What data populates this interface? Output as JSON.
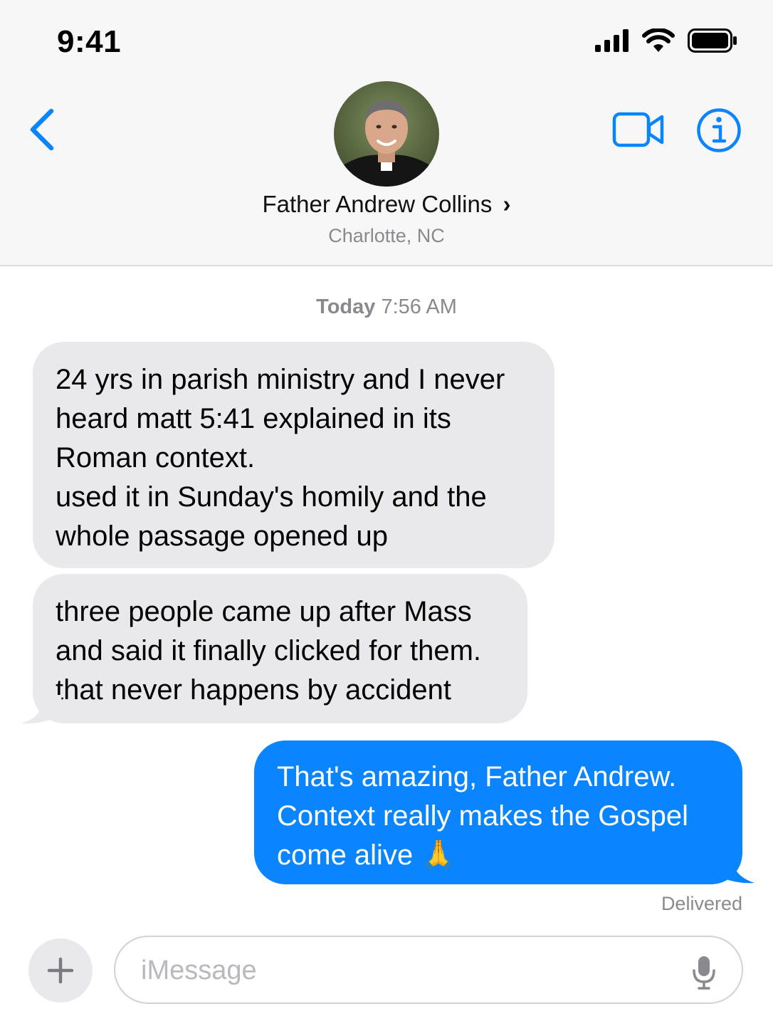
{
  "status_bar": {
    "time": "9:41"
  },
  "header": {
    "contact_name": "Father Andrew Collins",
    "contact_chevron": "›",
    "contact_subtitle": "Charlotte, NC",
    "icons": [
      "back-chevron-icon",
      "video-camera-icon",
      "info-icon"
    ],
    "accent_color": "#0a84ff"
  },
  "conversation": {
    "timestamp_day": "Today",
    "timestamp_time": "7:56 AM",
    "messages": [
      {
        "direction": "incoming",
        "text": "24 yrs in parish ministry and I never\nheard matt 5:41 explained in its\nRoman context.\nused it in Sunday's homily and the\nwhole passage opened up"
      },
      {
        "direction": "incoming",
        "text": "three people came up after Mass\nand said it finally clicked for them.\nthat never happens by accident"
      },
      {
        "direction": "outgoing",
        "text": "That's amazing, Father Andrew.\nContext really makes the Gospel\ncome alive 🙏"
      }
    ],
    "delivery_status": "Delivered"
  },
  "composer": {
    "placeholder": "iMessage",
    "value": "",
    "icons": [
      "plus-icon",
      "microphone-icon"
    ]
  },
  "colors": {
    "incoming_bubble": "#e9e9eb",
    "outgoing_bubble": "#0a84ff",
    "header_bg": "#f7f7f7"
  }
}
